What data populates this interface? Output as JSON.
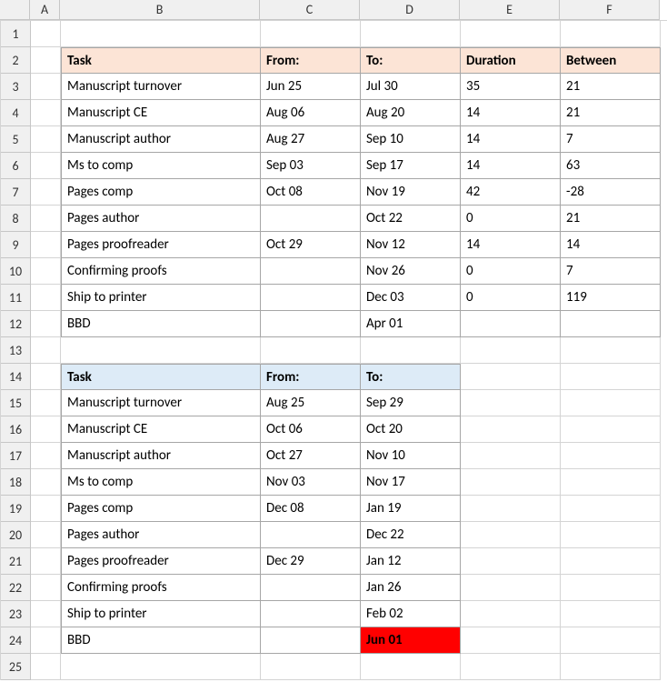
{
  "columns": [
    "",
    "A",
    "B",
    "C",
    "D",
    "E",
    "F"
  ],
  "rowcount": 25,
  "table1": {
    "header": {
      "task": "Task",
      "from": "From:",
      "to": "To:",
      "duration": "Duration",
      "between": "Between"
    },
    "rows": [
      {
        "task": "Manuscript turnover",
        "from": "Jun 25",
        "to": "Jul 30",
        "duration": "35",
        "between": "21"
      },
      {
        "task": "Manuscript CE",
        "from": "Aug 06",
        "to": "Aug 20",
        "duration": "14",
        "between": "21"
      },
      {
        "task": "Manuscript author",
        "from": "Aug 27",
        "to": "Sep 10",
        "duration": "14",
        "between": "7"
      },
      {
        "task": "Ms to comp",
        "from": "Sep 03",
        "to": "Sep 17",
        "duration": "14",
        "between": "63"
      },
      {
        "task": "Pages comp",
        "from": "Oct 08",
        "to": "Nov 19",
        "duration": "42",
        "between": "-28"
      },
      {
        "task": "Pages author",
        "from": "",
        "to": "Oct 22",
        "duration": "0",
        "between": "21"
      },
      {
        "task": "Pages proofreader",
        "from": "Oct 29",
        "to": "Nov 12",
        "duration": "14",
        "between": "14"
      },
      {
        "task": "Confirming proofs",
        "from": "",
        "to": "Nov 26",
        "duration": "0",
        "between": "7"
      },
      {
        "task": "Ship to printer",
        "from": "",
        "to": "Dec 03",
        "duration": "0",
        "between": "119"
      },
      {
        "task": "BBD",
        "from": "",
        "to": "Apr 01",
        "duration": "",
        "between": ""
      }
    ]
  },
  "table2": {
    "header": {
      "task": "Task",
      "from": "From:",
      "to": "To:"
    },
    "rows": [
      {
        "task": "Manuscript turnover",
        "from": "Aug 25",
        "to": "Sep 29"
      },
      {
        "task": "Manuscript CE",
        "from": "Oct 06",
        "to": "Oct 20"
      },
      {
        "task": "Manuscript author",
        "from": "Oct 27",
        "to": "Nov 10"
      },
      {
        "task": "Ms to comp",
        "from": "Nov 03",
        "to": "Nov 17"
      },
      {
        "task": "Pages comp",
        "from": "Dec 08",
        "to": "Jan 19"
      },
      {
        "task": "Pages author",
        "from": "",
        "to": "Dec 22"
      },
      {
        "task": "Pages proofreader",
        "from": "Dec 29",
        "to": "Jan 12"
      },
      {
        "task": "Confirming proofs",
        "from": "",
        "to": "Jan 26"
      },
      {
        "task": "Ship to printer",
        "from": "",
        "to": "Feb 02"
      },
      {
        "task": "BBD",
        "from": "",
        "to": "Jun 01",
        "highlight": true
      }
    ]
  },
  "chart_data": {
    "type": "table",
    "tables": [
      {
        "title": "Schedule 1",
        "columns": [
          "Task",
          "From:",
          "To:",
          "Duration",
          "Between"
        ],
        "rows": [
          [
            "Manuscript turnover",
            "Jun 25",
            "Jul 30",
            35,
            21
          ],
          [
            "Manuscript CE",
            "Aug 06",
            "Aug 20",
            14,
            21
          ],
          [
            "Manuscript author",
            "Aug 27",
            "Sep 10",
            14,
            7
          ],
          [
            "Ms to comp",
            "Sep 03",
            "Sep 17",
            14,
            63
          ],
          [
            "Pages comp",
            "Oct 08",
            "Nov 19",
            42,
            -28
          ],
          [
            "Pages author",
            null,
            "Oct 22",
            0,
            21
          ],
          [
            "Pages proofreader",
            "Oct 29",
            "Nov 12",
            14,
            14
          ],
          [
            "Confirming proofs",
            null,
            "Nov 26",
            0,
            7
          ],
          [
            "Ship to printer",
            null,
            "Dec 03",
            0,
            119
          ],
          [
            "BBD",
            null,
            "Apr 01",
            null,
            null
          ]
        ]
      },
      {
        "title": "Schedule 2",
        "columns": [
          "Task",
          "From:",
          "To:"
        ],
        "rows": [
          [
            "Manuscript turnover",
            "Aug 25",
            "Sep 29"
          ],
          [
            "Manuscript CE",
            "Oct 06",
            "Oct 20"
          ],
          [
            "Manuscript author",
            "Oct 27",
            "Nov 10"
          ],
          [
            "Ms to comp",
            "Nov 03",
            "Nov 17"
          ],
          [
            "Pages comp",
            "Dec 08",
            "Jan 19"
          ],
          [
            "Pages author",
            null,
            "Dec 22"
          ],
          [
            "Pages proofreader",
            "Dec 29",
            "Jan 12"
          ],
          [
            "Confirming proofs",
            null,
            "Jan 26"
          ],
          [
            "Ship to printer",
            null,
            "Feb 02"
          ],
          [
            "BBD",
            null,
            "Jun 01"
          ]
        ]
      }
    ]
  }
}
